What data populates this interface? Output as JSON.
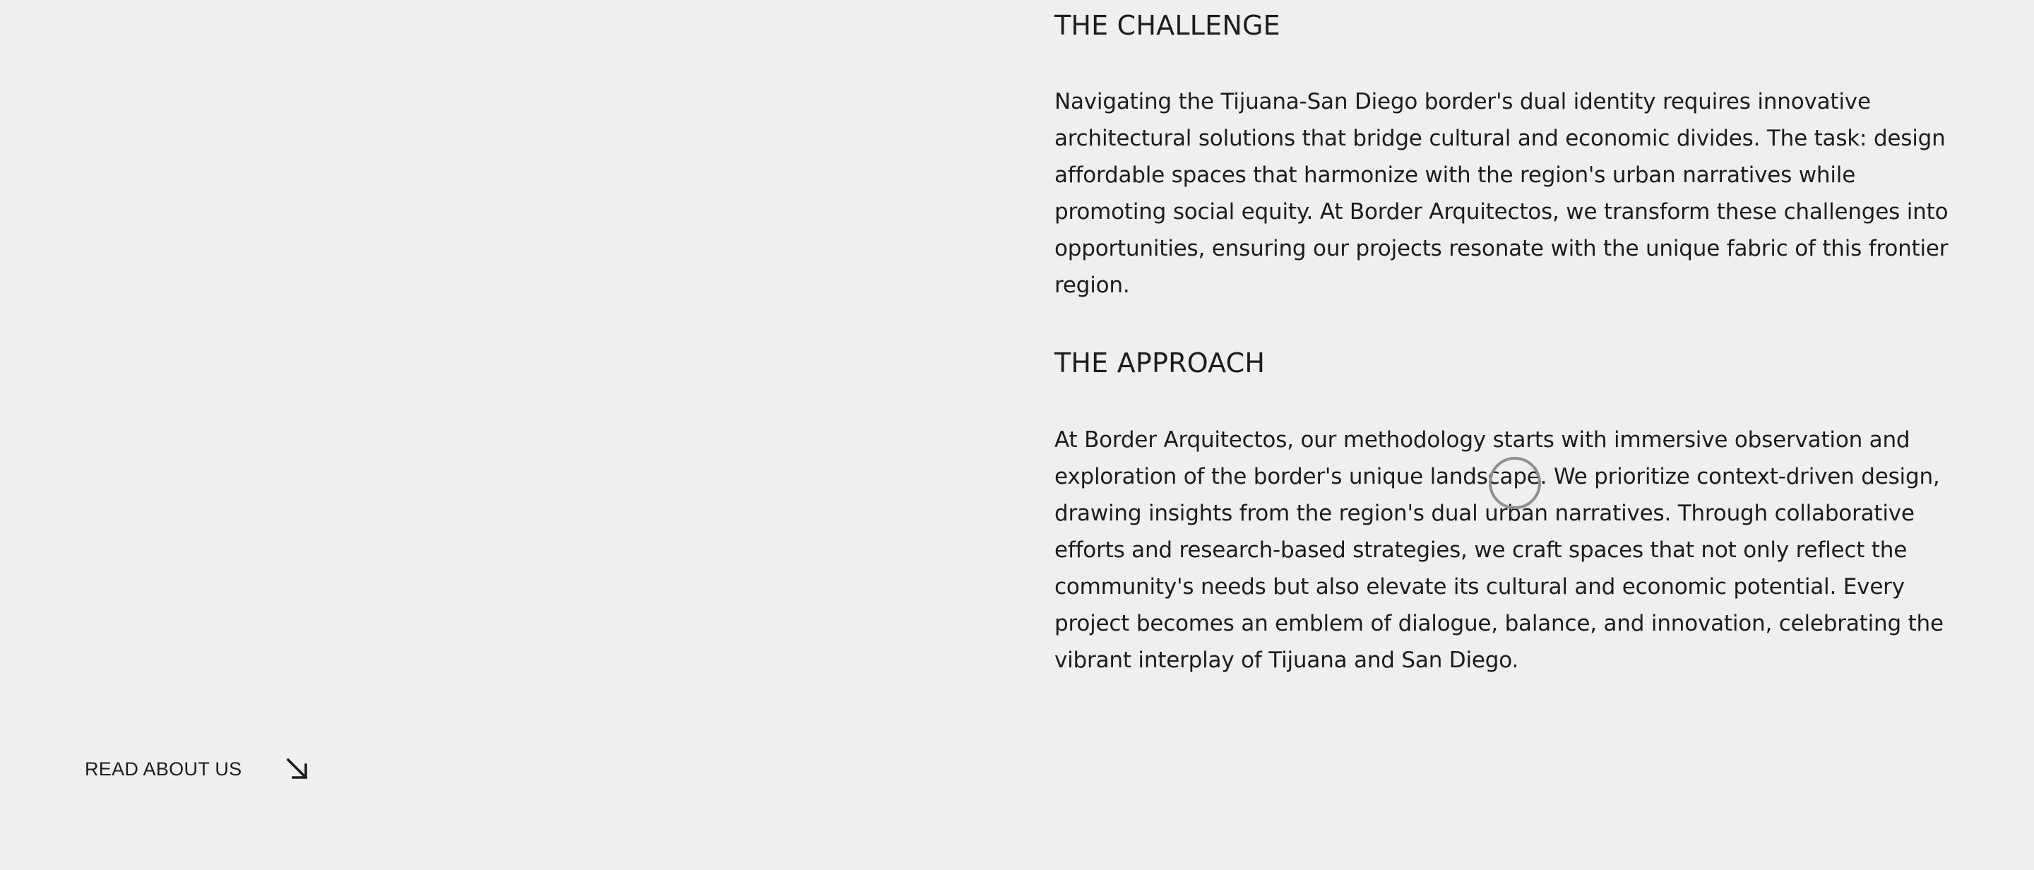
{
  "challenge": {
    "heading": "THE CHALLENGE",
    "text": "Navigating the Tijuana-San Diego border's dual identity requires innovative architectural solutions that bridge cultural and economic divides. The task: design affordable spaces that harmonize with the region's urban narratives while promoting social equity. At Border Arquitectos, we transform these challenges into opportunities, ensuring our projects resonate with the unique fabric of this frontier region."
  },
  "approach": {
    "heading": "THE APPROACH",
    "text": "At Border Arquitectos, our methodology starts with immersive observation and exploration of the border's unique landscape. We prioritize context-driven design, drawing insights from the region's dual urban narratives. Through collaborative efforts and research-based strategies, we craft spaces that not only reflect the community's needs but also elevate its cultural and economic potential. Every project becomes an emblem of dialogue, balance, and innovation, celebrating the vibrant interplay of Tijuana and San Diego."
  },
  "cta": {
    "label": "READ ABOUT US",
    "icon": "arrow-down-right-icon"
  },
  "colors": {
    "background": "#efefef",
    "text": "#1c1c1c",
    "cursor_ring": "#8f8f8f"
  }
}
